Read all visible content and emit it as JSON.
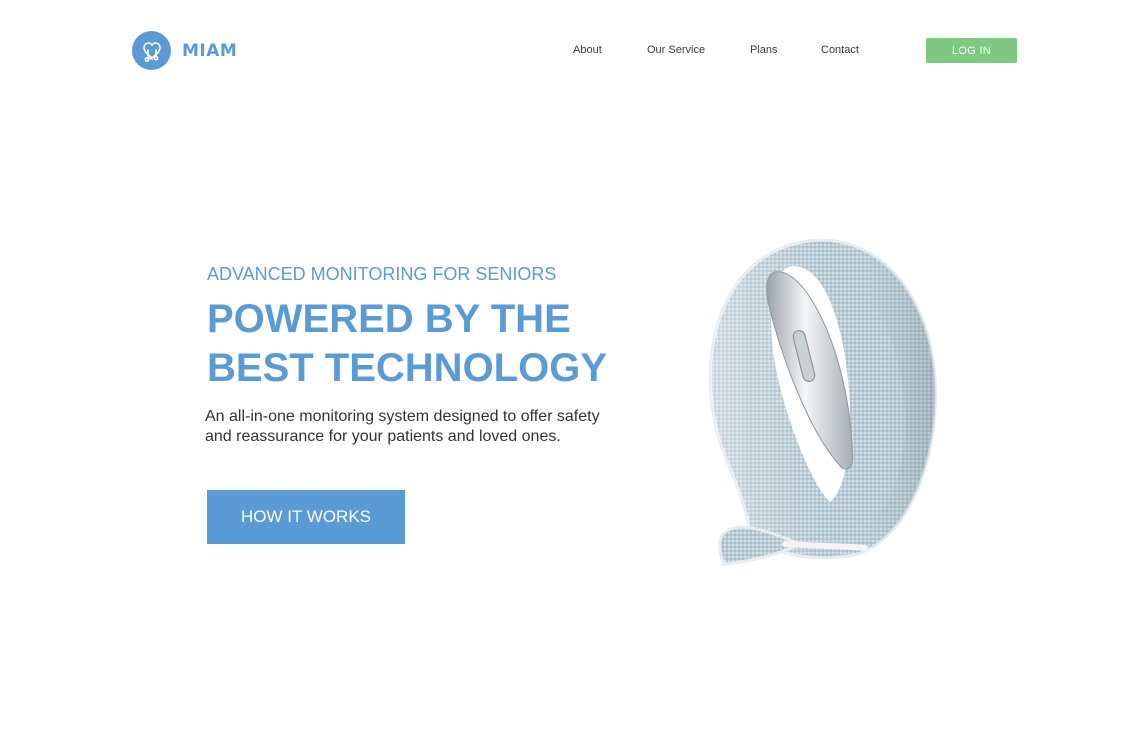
{
  "brand": {
    "name": "MIAM",
    "logo_icon": "heart-stethoscope-icon",
    "color": "#5b9bd5"
  },
  "nav": {
    "items": [
      {
        "label": "About"
      },
      {
        "label": "Our Service"
      },
      {
        "label": "Plans"
      },
      {
        "label": "Contact"
      }
    ],
    "login_label": "LOG IN",
    "login_color": "#7dc97f"
  },
  "hero": {
    "eyebrow": "ADVANCED MONITORING FOR SENIORS",
    "title_line1": "POWERED BY THE",
    "title_line2": "BEST TECHNOLOGY",
    "body": "An all-in-one monitoring system designed to offer safety and reassurance for your patients and loved ones.",
    "cta_label": "HOW IT WORKS",
    "accent": "#5b9bd5"
  },
  "product_image": {
    "subject": "wristband-image"
  }
}
